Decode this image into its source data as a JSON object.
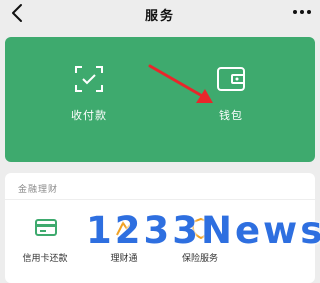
{
  "nav": {
    "title": "服务"
  },
  "panel": {
    "items": [
      {
        "label": "收付款",
        "icon": "qr-scan-icon"
      },
      {
        "label": "钱包",
        "icon": "wallet-icon"
      }
    ],
    "color": "#3eaa6e"
  },
  "finance": {
    "section_title": "金融理财",
    "items": [
      {
        "label": "信用卡还款",
        "icon": "credit-card-icon"
      },
      {
        "label": "理财通",
        "icon": "wealth-icon"
      },
      {
        "label": "保险服务",
        "icon": "insurance-icon"
      }
    ]
  },
  "watermark": "1233News",
  "colors": {
    "accent_green": "#3eaa6e",
    "arrow_red": "#e8262b",
    "watermark_blue": "#2e6fe0"
  }
}
